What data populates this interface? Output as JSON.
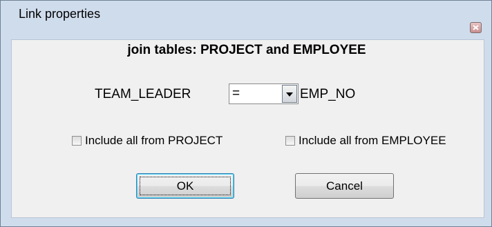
{
  "window": {
    "title": "Link properties",
    "close_icon": "close-icon",
    "close_color": "#c44a4a"
  },
  "dialog": {
    "heading": "join tables: PROJECT and EMPLOYEE",
    "left_field": "TEAM_LEADER",
    "operator": {
      "selected": "="
    },
    "right_field": "EMP_NO",
    "include_left": {
      "label": "Include all from PROJECT",
      "checked": false
    },
    "include_right": {
      "label": "Include all from EMPLOYEE",
      "checked": false
    },
    "ok_label": "OK",
    "cancel_label": "Cancel"
  },
  "colors": {
    "frame": "#cfdcec",
    "client": "#f0f0f0"
  }
}
